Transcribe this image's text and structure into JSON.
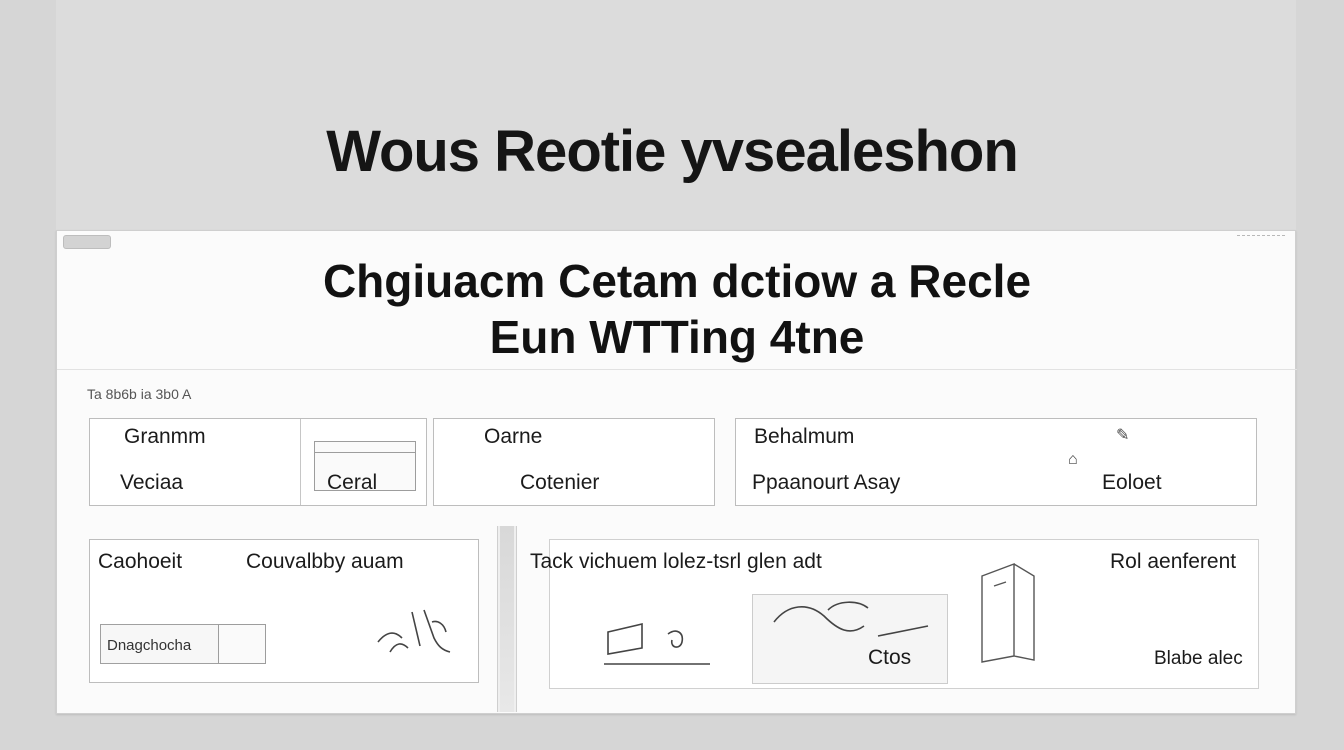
{
  "window": {
    "title": "Wous Reotie yvsealeshon"
  },
  "panel": {
    "heading_line1": "Chgiuacm Cetam dctiow a Recle",
    "heading_line2": "Eun WTTing 4tne",
    "breadcrumb": "Ta 8b6b ia 3b0 A"
  },
  "top_cards": [
    {
      "label": "Granmm",
      "sublabel": "Veciaa",
      "side_label": "Ceral"
    },
    {
      "label": "Oarne",
      "sublabel": "Cotenier"
    },
    {
      "label": "Behalmum",
      "sublabel": "Ppaanourt Asay",
      "side_label": "Eoloet"
    }
  ],
  "bottom_left": {
    "title": "Caohoeit",
    "subtitle": "Couvalbby auam",
    "input_label": "Dnagchocha"
  },
  "bottom_right": {
    "title": "Tack vichuem lolez-tsrl glen adt",
    "side_title": "Rol aenferent",
    "caption_left": "Ctos",
    "caption_right": "Blabe alec"
  },
  "icons": {
    "card_top_right": "pencil-icon",
    "card_mid_right": "eraser-icon",
    "bottom_left_sketch": "hands-sketch-icon",
    "bottom_right_sketch_a": "laptop-sketch-icon",
    "bottom_right_sketch_b": "figure-sketch-icon",
    "bottom_right_sketch_c": "cabinet-sketch-icon"
  }
}
